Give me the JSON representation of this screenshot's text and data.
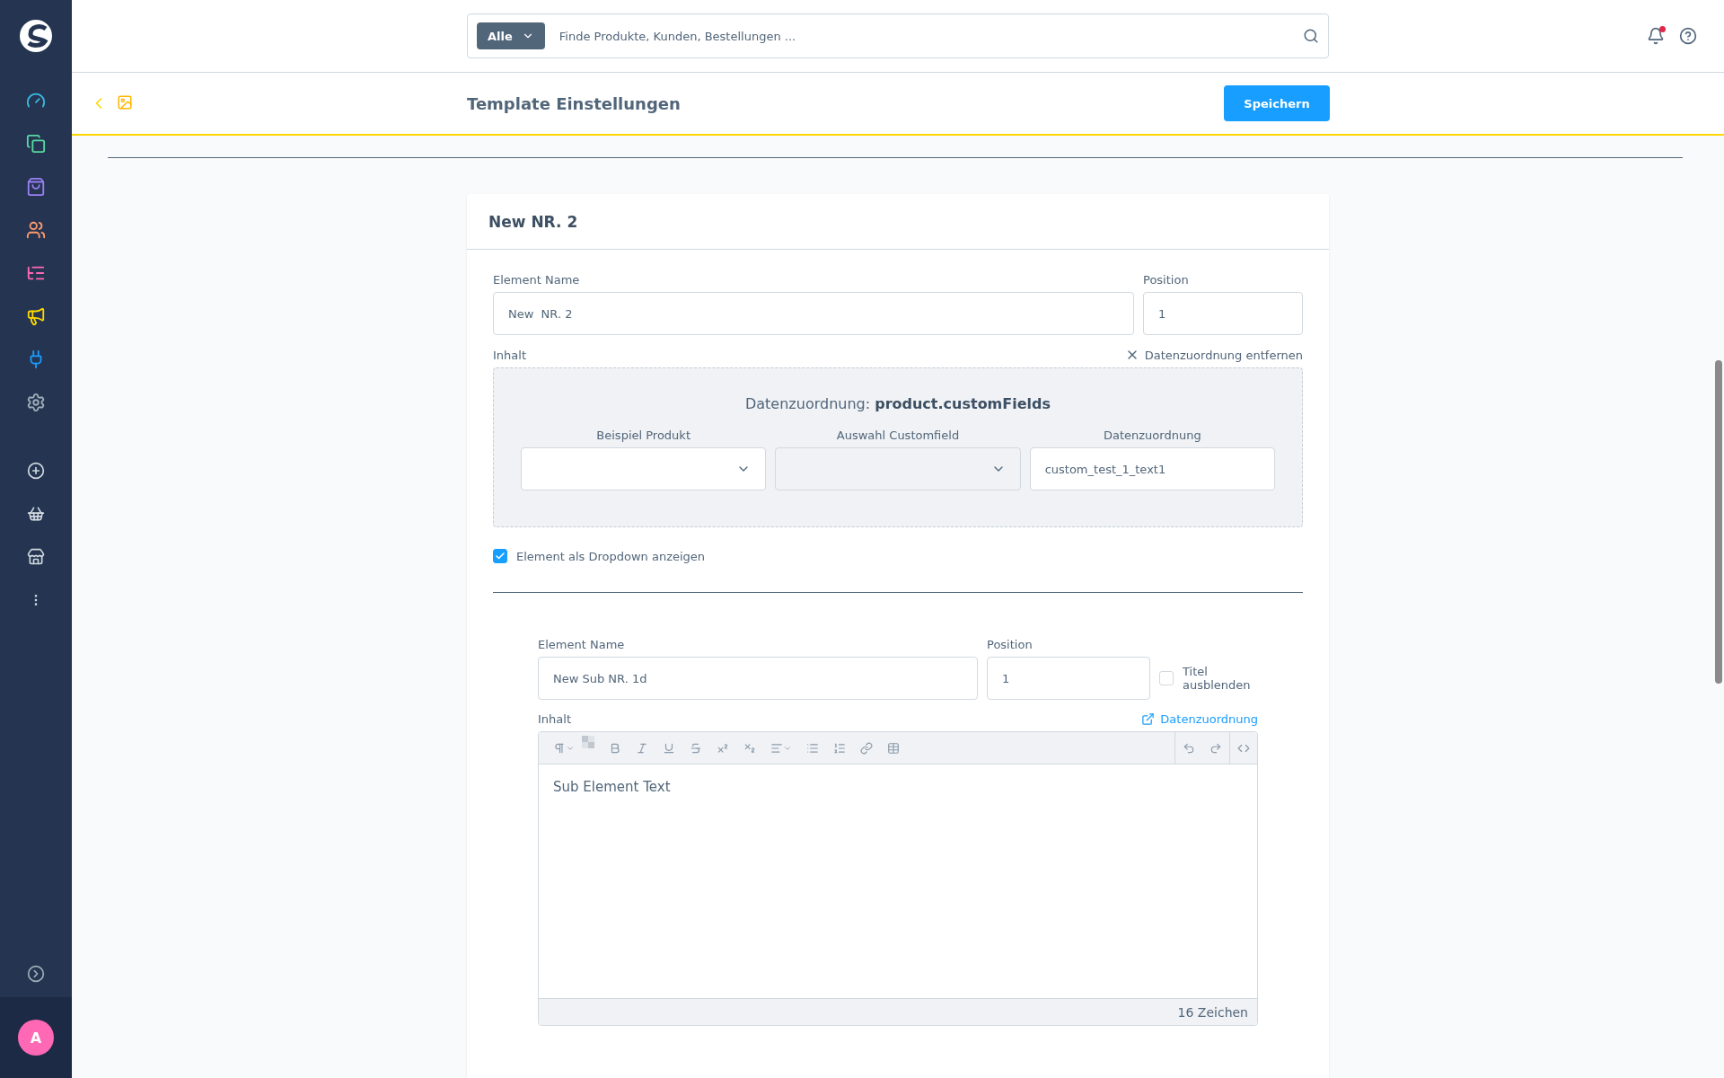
{
  "sidebar": {
    "avatar": "A"
  },
  "header": {
    "search": {
      "scope": "Alle",
      "placeholder": "Finde Produkte, Kunden, Bestellungen ..."
    },
    "notifications": {
      "unread": true
    }
  },
  "toolbar": {
    "title": "Template Einstellungen",
    "save_button": "Speichern"
  },
  "card": {
    "title": "New NR. 2",
    "element_name": {
      "label": "Element Name",
      "value": "New  NR. 2"
    },
    "position": {
      "label": "Position",
      "value": "1"
    },
    "content_label": "Inhalt",
    "remove_mapping": "Datenzuordnung entfernen",
    "mapping": {
      "title": "Datenzuordnung: **product.customFields**",
      "fields": [
        {
          "kind": "select",
          "label": "Beispiel Produkt",
          "disabled": false
        },
        {
          "kind": "select",
          "label": "Auswahl Customfield",
          "disabled": true
        },
        {
          "kind": "input",
          "label": "Datenzuordnung",
          "value": "custom_test_1_text1"
        }
      ]
    },
    "dropdown_option": {
      "label": "Element als Dropdown anzeigen",
      "checked": true
    },
    "sub_element": {
      "element_name": {
        "label": "Element Name",
        "value": "New Sub NR. 1d"
      },
      "position": {
        "label": "Position",
        "value": "1"
      },
      "hide_title": {
        "label": "Titel ausblenden",
        "checked": false
      },
      "content_label": "Inhalt",
      "mapping_link": "Datenzuordnung",
      "editor": {
        "text": "Sub Element Text",
        "char_count": "16 Zeichen"
      }
    }
  }
}
